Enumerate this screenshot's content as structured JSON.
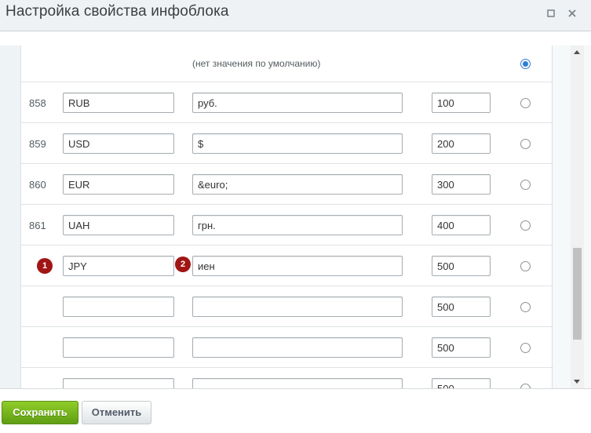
{
  "window": {
    "title": "Настройка свойства инфоблока"
  },
  "table": {
    "default_row_text": "(нет значения по умолчанию)",
    "default_selected": true,
    "rows": [
      {
        "id": "858",
        "xml_id": "RUB",
        "value": "руб.",
        "sort": "100",
        "default": false
      },
      {
        "id": "859",
        "xml_id": "USD",
        "value": "$",
        "sort": "200",
        "default": false
      },
      {
        "id": "860",
        "xml_id": "EUR",
        "value": "&euro;",
        "sort": "300",
        "default": false
      },
      {
        "id": "861",
        "xml_id": "UAH",
        "value": "грн.",
        "sort": "400",
        "default": false
      },
      {
        "id": "",
        "xml_id": "JPY",
        "value": "иен",
        "sort": "500",
        "default": false
      },
      {
        "id": "",
        "xml_id": "",
        "value": "",
        "sort": "500",
        "default": false
      },
      {
        "id": "",
        "xml_id": "",
        "value": "",
        "sort": "500",
        "default": false
      },
      {
        "id": "",
        "xml_id": "",
        "value": "",
        "sort": "500",
        "default": false
      }
    ]
  },
  "badges": [
    "1",
    "2"
  ],
  "footer": {
    "save_label": "Сохранить",
    "cancel_label": "Отменить"
  },
  "colors": {
    "save_button": "#6fb31b",
    "badge": "#a11515",
    "radio_checked": "#2e7dd8"
  }
}
